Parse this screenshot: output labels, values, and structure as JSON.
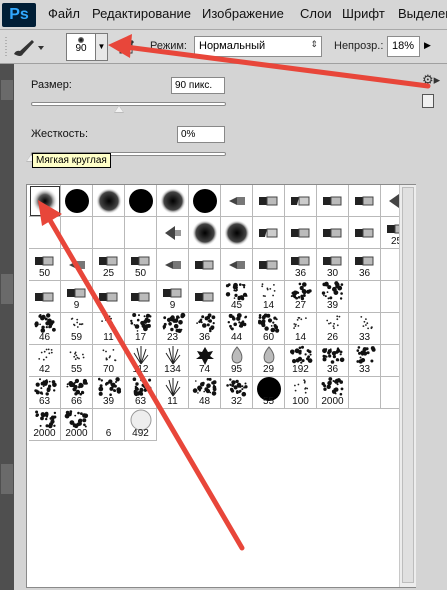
{
  "app": {
    "logo": "Ps"
  },
  "menu": [
    {
      "label": "Файл"
    },
    {
      "label": "Редактирование"
    },
    {
      "label": "Изображение"
    },
    {
      "label": "Слои"
    },
    {
      "label": "Шрифт"
    },
    {
      "label": "Выделен"
    }
  ],
  "options": {
    "brush_size": "90",
    "mode_label": "Режим:",
    "mode_value": "Нормальный",
    "opacity_label": "Непрозр.:",
    "opacity_value": "18%"
  },
  "panel": {
    "size_label": "Размер:",
    "size_value": "90 пикс.",
    "size_slider_fraction": 0.45,
    "hardness_label": "Жесткость:",
    "hardness_value": "0%",
    "hardness_slider_fraction": 0.0,
    "tooltip": "Мягкая круглая"
  },
  "brush_rows": [
    [
      {
        "k": "soft",
        "n": ""
      },
      {
        "k": "hard",
        "n": ""
      },
      {
        "k": "soft2",
        "n": ""
      },
      {
        "k": "hard",
        "n": ""
      },
      {
        "k": "soft2",
        "n": ""
      },
      {
        "k": "hard",
        "n": ""
      },
      {
        "k": "tip",
        "n": ""
      },
      {
        "k": "pen",
        "n": ""
      },
      {
        "k": "marker",
        "n": ""
      },
      {
        "k": "pen",
        "n": ""
      },
      {
        "k": "pen",
        "n": ""
      },
      {
        "k": "fan",
        "n": ""
      }
    ],
    [
      {
        "k": "blank",
        "n": ""
      },
      {
        "k": "blank",
        "n": ""
      },
      {
        "k": "blank",
        "n": ""
      },
      {
        "k": "blank",
        "n": ""
      },
      {
        "k": "fan",
        "n": ""
      },
      {
        "k": "soft2",
        "n": ""
      },
      {
        "k": "soft2",
        "n": ""
      },
      {
        "k": "marker",
        "n": ""
      },
      {
        "k": "pen",
        "n": ""
      },
      {
        "k": "pen",
        "n": ""
      },
      {
        "k": "pen",
        "n": ""
      },
      {
        "k": "pen",
        "n": "25"
      }
    ],
    [
      {
        "k": "pen",
        "n": "50"
      },
      {
        "k": "tip",
        "n": ""
      },
      {
        "k": "pen",
        "n": "25"
      },
      {
        "k": "pen",
        "n": "50"
      },
      {
        "k": "tip",
        "n": ""
      },
      {
        "k": "pen",
        "n": ""
      },
      {
        "k": "tip",
        "n": ""
      },
      {
        "k": "pen",
        "n": ""
      },
      {
        "k": "pen",
        "n": "36"
      },
      {
        "k": "pen",
        "n": "30"
      },
      {
        "k": "pen",
        "n": "36"
      },
      {
        "k": "blank",
        "n": ""
      }
    ],
    [
      {
        "k": "pen",
        "n": ""
      },
      {
        "k": "pen",
        "n": "9"
      },
      {
        "k": "pen",
        "n": ""
      },
      {
        "k": "pen",
        "n": ""
      },
      {
        "k": "pen",
        "n": "9"
      },
      {
        "k": "pen",
        "n": ""
      },
      {
        "k": "splat",
        "n": "45"
      },
      {
        "k": "dots",
        "n": "14"
      },
      {
        "k": "splat",
        "n": "27"
      },
      {
        "k": "splat",
        "n": "39"
      },
      {
        "k": "blank",
        "n": ""
      },
      {
        "k": "blank",
        "n": ""
      }
    ],
    [
      {
        "k": "splat",
        "n": "46"
      },
      {
        "k": "dots",
        "n": "59"
      },
      {
        "k": "dots",
        "n": "11"
      },
      {
        "k": "splat",
        "n": "17"
      },
      {
        "k": "splat",
        "n": "23"
      },
      {
        "k": "splat",
        "n": "36"
      },
      {
        "k": "splat",
        "n": "44"
      },
      {
        "k": "splat",
        "n": "60"
      },
      {
        "k": "dots",
        "n": "14"
      },
      {
        "k": "dots",
        "n": "26"
      },
      {
        "k": "dots",
        "n": "33"
      },
      {
        "k": "blank",
        "n": ""
      }
    ],
    [
      {
        "k": "dots",
        "n": "42"
      },
      {
        "k": "dots",
        "n": "55"
      },
      {
        "k": "dots",
        "n": "70"
      },
      {
        "k": "grass",
        "n": "112"
      },
      {
        "k": "grass",
        "n": "134"
      },
      {
        "k": "leaf",
        "n": "74"
      },
      {
        "k": "drop",
        "n": "95"
      },
      {
        "k": "drop",
        "n": "29"
      },
      {
        "k": "splat",
        "n": "192"
      },
      {
        "k": "splat",
        "n": "36"
      },
      {
        "k": "splat",
        "n": "33"
      },
      {
        "k": "blank",
        "n": ""
      }
    ],
    [
      {
        "k": "splat",
        "n": "63"
      },
      {
        "k": "splat",
        "n": "66"
      },
      {
        "k": "splat",
        "n": "39"
      },
      {
        "k": "splat",
        "n": "63"
      },
      {
        "k": "grass",
        "n": "11"
      },
      {
        "k": "splat",
        "n": "48"
      },
      {
        "k": "splat",
        "n": "32"
      },
      {
        "k": "hard",
        "n": "55"
      },
      {
        "k": "dots",
        "n": "100"
      },
      {
        "k": "splat",
        "n": "2000"
      },
      {
        "k": "blank",
        "n": ""
      },
      {
        "k": "blank",
        "n": ""
      }
    ],
    [
      {
        "k": "splat",
        "n": "2000"
      },
      {
        "k": "splat",
        "n": "2000"
      },
      {
        "k": "blank",
        "n": "6"
      },
      {
        "k": "circle",
        "n": "492"
      },
      {
        "k": "none",
        "n": ""
      },
      {
        "k": "none",
        "n": ""
      },
      {
        "k": "none",
        "n": ""
      },
      {
        "k": "none",
        "n": ""
      },
      {
        "k": "none",
        "n": ""
      },
      {
        "k": "none",
        "n": ""
      },
      {
        "k": "none",
        "n": ""
      },
      {
        "k": "none",
        "n": ""
      }
    ]
  ],
  "colors": {
    "arrow": "#e8463a",
    "panel_bg": "#d4d4d4",
    "ps_blue": "#31a8ff"
  }
}
